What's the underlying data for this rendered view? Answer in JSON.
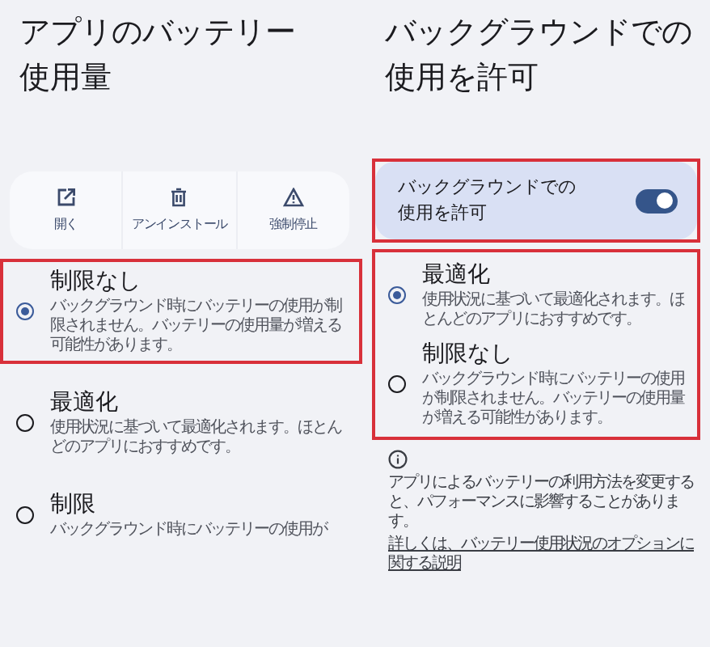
{
  "left_screen": {
    "title": "アプリのバッテリー使用量",
    "actions": [
      {
        "kind": "open",
        "label": "開く"
      },
      {
        "kind": "uninstall",
        "label": "アンインストール"
      },
      {
        "kind": "force_stop",
        "label": "強制停止"
      }
    ],
    "options": [
      {
        "title": "制限なし",
        "description": "バックグラウンド時にバッテリーの使用が制限されません。バッテリーの使用量が増える可能性があります。",
        "selected": true,
        "highlighted": true
      },
      {
        "title": "最適化",
        "description": "使用状況に基づいて最適化されます。ほとんどのアプリにおすすめです。",
        "selected": false,
        "highlighted": false
      },
      {
        "title": "制限",
        "description": "バックグラウンド時にバッテリーの使用が",
        "selected": false,
        "highlighted": false
      }
    ]
  },
  "right_screen": {
    "title": "バックグラウンドでの使用を許可",
    "toggle": {
      "label": "バックグラウンドでの使用を許可",
      "on": true,
      "highlighted": true
    },
    "options_highlighted": true,
    "options": [
      {
        "title": "最適化",
        "description": "使用状況に基づいて最適化されます。ほとんどのアプリにおすすめです。",
        "selected": true
      },
      {
        "title": "制限なし",
        "description": "バックグラウンド時にバッテリーの使用が制限されません。バッテリーの使用量が増える可能性があります。",
        "selected": false
      }
    ],
    "info_text": "アプリによるバッテリーの利用方法を変更すると、パフォーマンスに影響することがあります。",
    "link": "詳しくは、バッテリー使用状況のオプションに関する説明"
  }
}
